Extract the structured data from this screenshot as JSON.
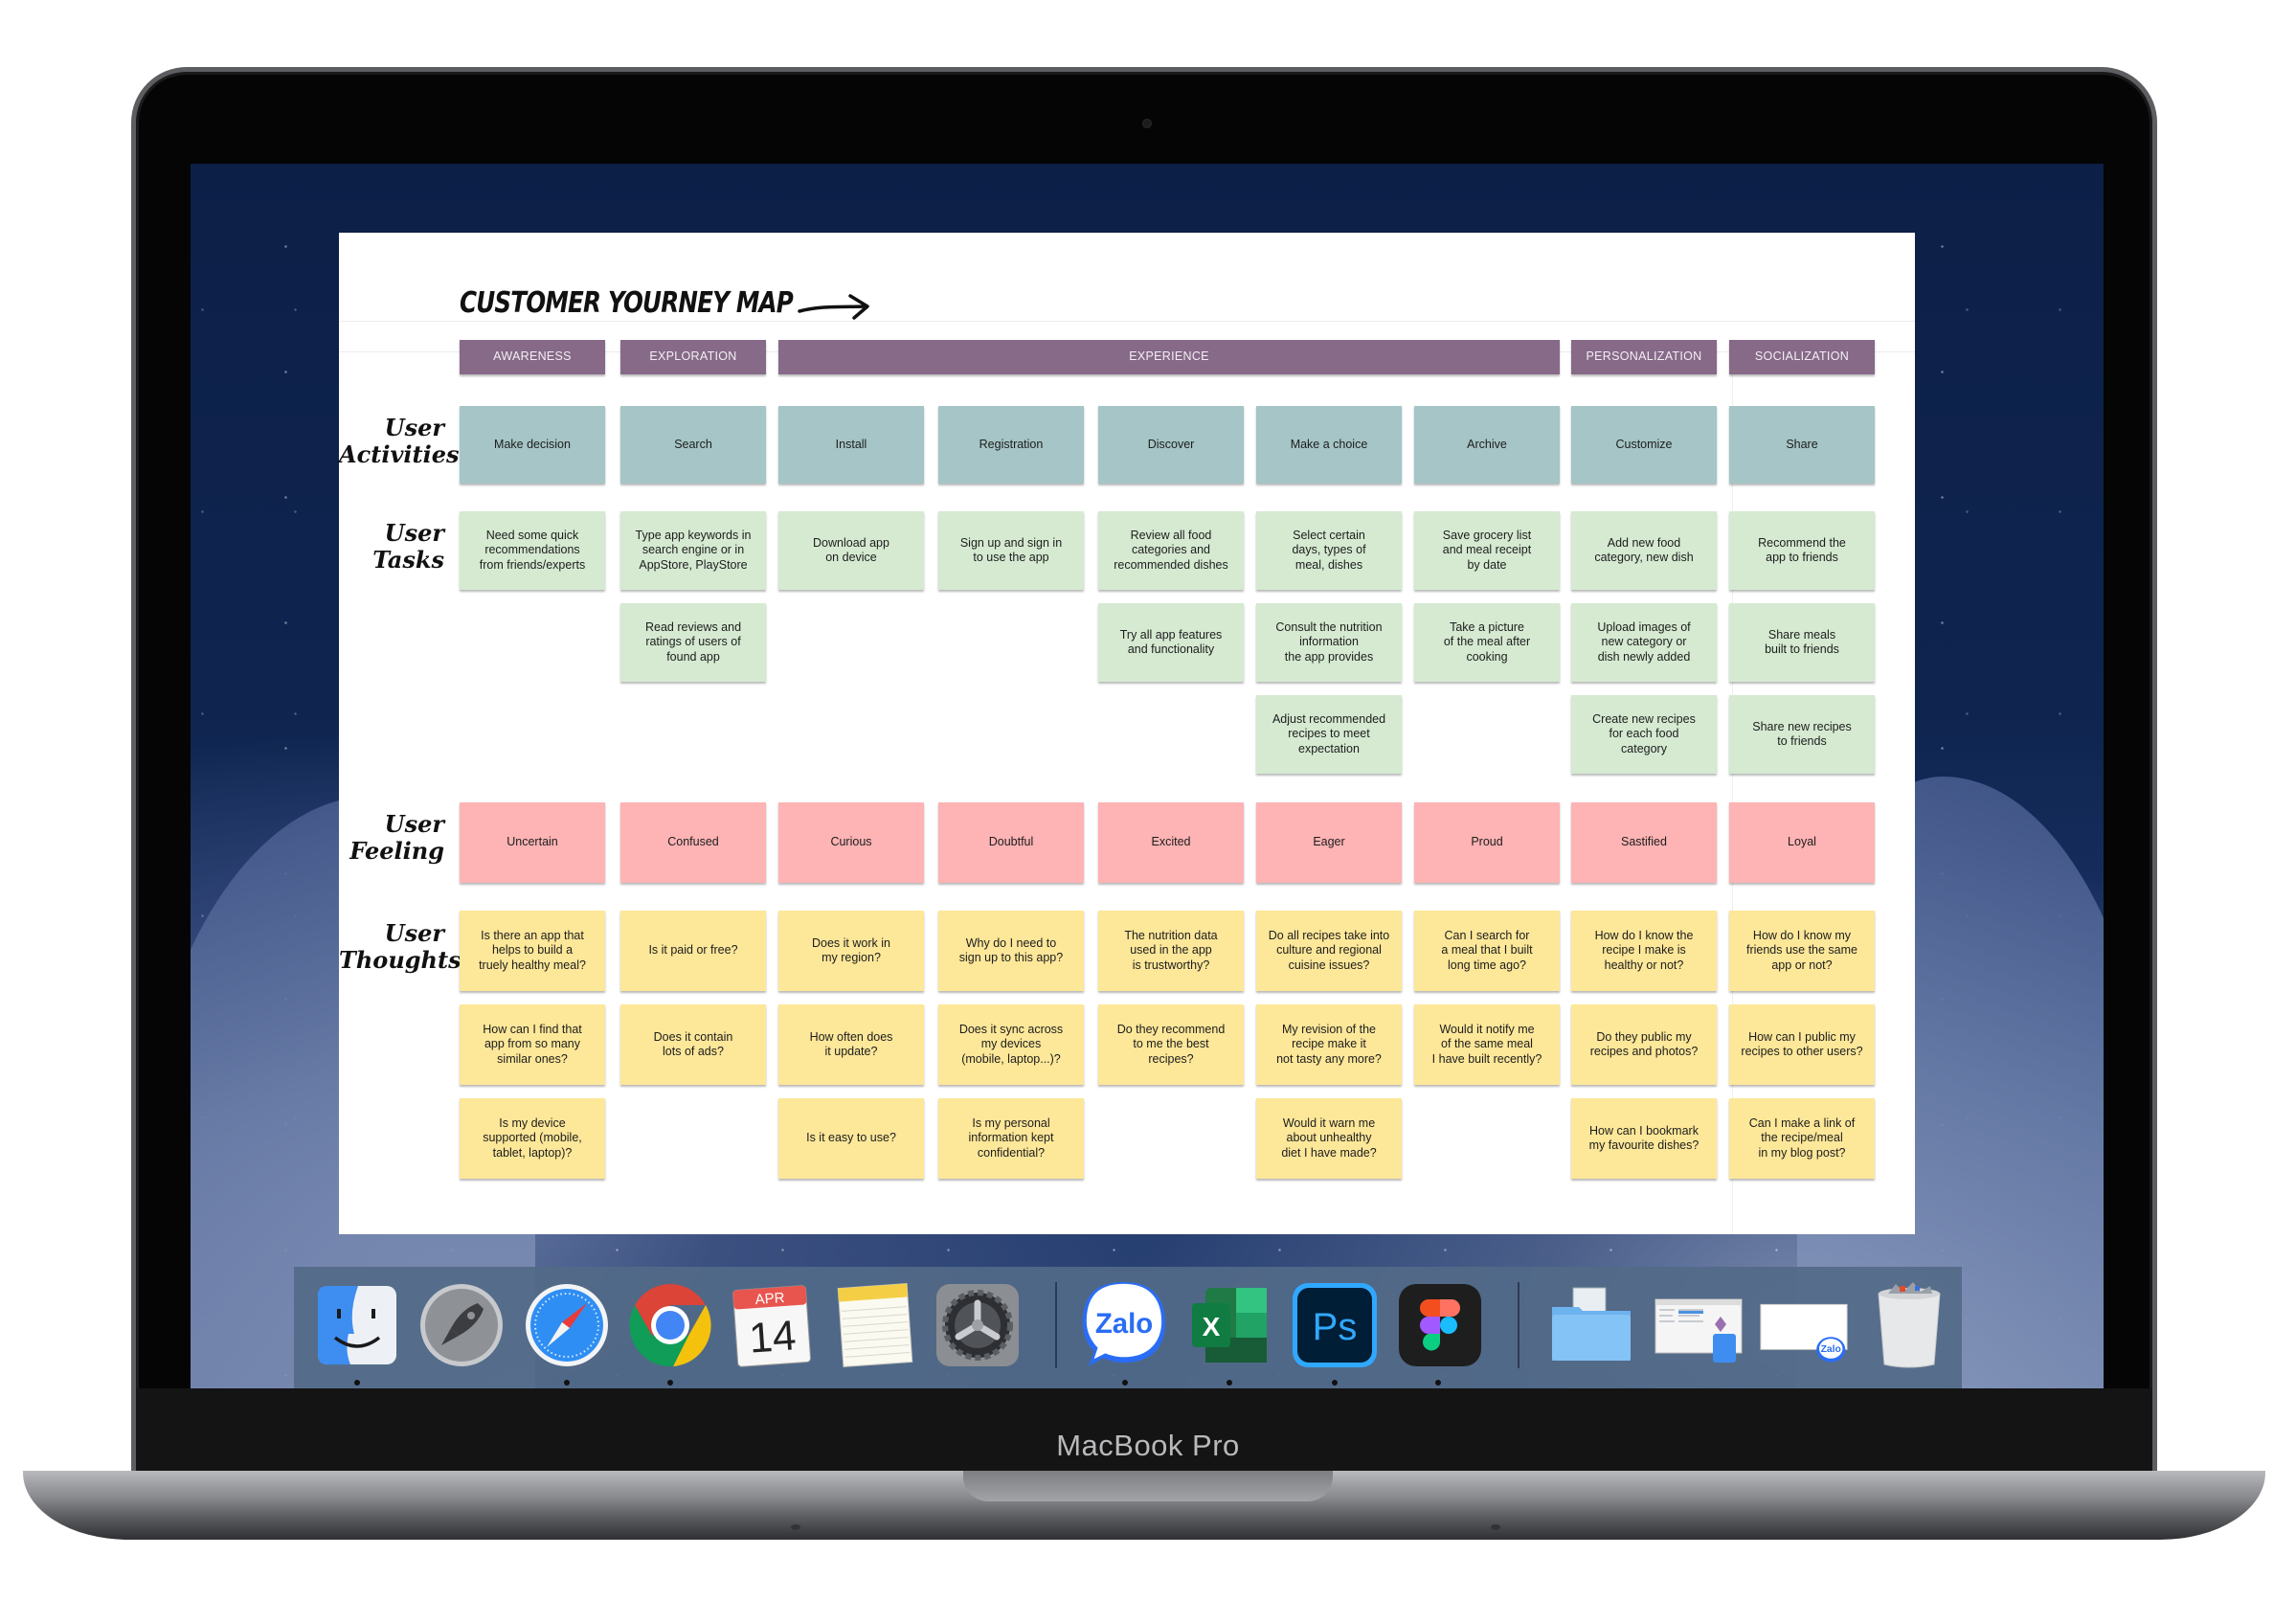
{
  "device": {
    "brand_label": "MacBook Pro"
  },
  "board": {
    "title": "CUSTOMER YOURNEY MAP",
    "phases": [
      {
        "label": "AWARENESS",
        "span": [
          0,
          0
        ]
      },
      {
        "label": "EXPLORATION",
        "span": [
          1,
          1
        ]
      },
      {
        "label": "EXPERIENCE",
        "span": [
          2,
          6
        ]
      },
      {
        "label": "PERSONALIZATION",
        "span": [
          7,
          7
        ]
      },
      {
        "label": "SOCIALIZATION",
        "span": [
          8,
          8
        ]
      }
    ],
    "row_labels": {
      "activities": "User\nActivities",
      "tasks": "User\nTasks",
      "feeling": "User\nFeeling",
      "thoughts": "User\nThoughts"
    },
    "activities": [
      "Make decision",
      "Search",
      "Install",
      "Registration",
      "Discover",
      "Make a choice",
      "Archive",
      "Customize",
      "Share"
    ],
    "tasks": [
      [
        "Need some quick\nrecommendations\nfrom friends/experts",
        "Type app keywords in\nsearch engine or in\nAppStore, PlayStore",
        "Download app\non device",
        "Sign up and sign in\nto use the app",
        "Review all food\ncategories and\nrecommended dishes",
        "Select certain\ndays, types of\nmeal, dishes",
        "Save grocery list\nand meal receipt\nby date",
        "Add new food\ncategory, new dish",
        "Recommend the\napp to friends"
      ],
      [
        null,
        "Read reviews and\nratings of users of\nfound app",
        null,
        null,
        "Try all app features\nand functionality",
        "Consult the nutrition\ninformation\nthe app provides",
        "Take a picture\nof the meal after\ncooking",
        "Upload images of\nnew category or\ndish newly added",
        "Share meals\nbuilt to friends"
      ],
      [
        null,
        null,
        null,
        null,
        null,
        "Adjust recommended\nrecipes to meet\nexpectation",
        null,
        "Create new recipes\nfor each food\ncategory",
        "Share new recipes\nto friends"
      ]
    ],
    "feelings": [
      "Uncertain",
      "Confused",
      "Curious",
      "Doubtful",
      "Excited",
      "Eager",
      "Proud",
      "Sastified",
      "Loyal"
    ],
    "thoughts": [
      [
        "Is there an app that\nhelps to build a\ntruely healthy meal?",
        "Is it paid or free?",
        "Does it work in\nmy region?",
        "Why do I need to\nsign up to this app?",
        "The nutrition data\nused in the app\nis trustworthy?",
        "Do all recipes  take into\nculture and regional\ncuisine issues?",
        "Can I search for\na meal that I built\nlong time ago?",
        "How do I know the\nrecipe I make is\nhealthy or not?",
        "How do I know my\nfriends use the same\napp or not?"
      ],
      [
        "How can I find that\napp from so many\nsimilar ones?",
        "Does it contain\nlots of ads?",
        "How often does\nit update?",
        "Does it sync across\nmy devices\n(mobile, laptop...)?",
        "Do they recommend\nto me the best\nrecipes?",
        "My revision of the\nrecipe make it\nnot tasty any more?",
        "Would it notify me\nof the same meal\nI have built recently?",
        "Do they public my\nrecipes and photos?",
        "How can I public my\nrecipes to other users?"
      ],
      [
        "Is my device\nsupported (mobile,\ntablet, laptop)?",
        null,
        "Is it easy to use?",
        "Is  my personal\ninformation kept\nconfidential?",
        null,
        "Would it warn me\nabout unhealthy\ndiet I have made?",
        null,
        "How can I bookmark\nmy favourite dishes?",
        "Can I make a link of\nthe recipe/meal\nin my blog post?"
      ]
    ],
    "colors": {
      "phase": "#866a88",
      "activity": "#a5c5c6",
      "task": "#d5ead1",
      "feeling": "#feb3b4",
      "thought": "#fde799"
    }
  },
  "dock": {
    "items": [
      {
        "name": "finder",
        "icon": "finder-icon",
        "running": true
      },
      {
        "name": "launchpad",
        "icon": "rocket-icon",
        "running": false
      },
      {
        "name": "safari",
        "icon": "compass-icon",
        "running": true
      },
      {
        "name": "chrome",
        "icon": "chrome-icon",
        "running": true
      },
      {
        "name": "calendar",
        "icon": "calendar-icon",
        "running": false,
        "month": "APR",
        "day": "14"
      },
      {
        "name": "notes",
        "icon": "notepad-icon",
        "running": false
      },
      {
        "name": "system-preferences",
        "icon": "gear-icon",
        "running": false
      },
      {
        "name": "zalo",
        "icon": "zalo-icon",
        "running": true,
        "text": "Zalo"
      },
      {
        "name": "excel",
        "icon": "excel-icon",
        "running": true,
        "text": "X"
      },
      {
        "name": "photoshop",
        "icon": "photoshop-icon",
        "running": true,
        "text": "Ps"
      },
      {
        "name": "figma",
        "icon": "figma-icon",
        "running": true
      },
      {
        "name": "downloads-folder",
        "icon": "folder-icon",
        "running": false
      },
      {
        "name": "finder-window-preview",
        "icon": "window-preview-icon",
        "running": false
      },
      {
        "name": "zalo-window-preview",
        "icon": "window-preview-icon",
        "running": false,
        "text": "Zalo"
      },
      {
        "name": "trash",
        "icon": "trash-icon",
        "running": false
      }
    ]
  }
}
